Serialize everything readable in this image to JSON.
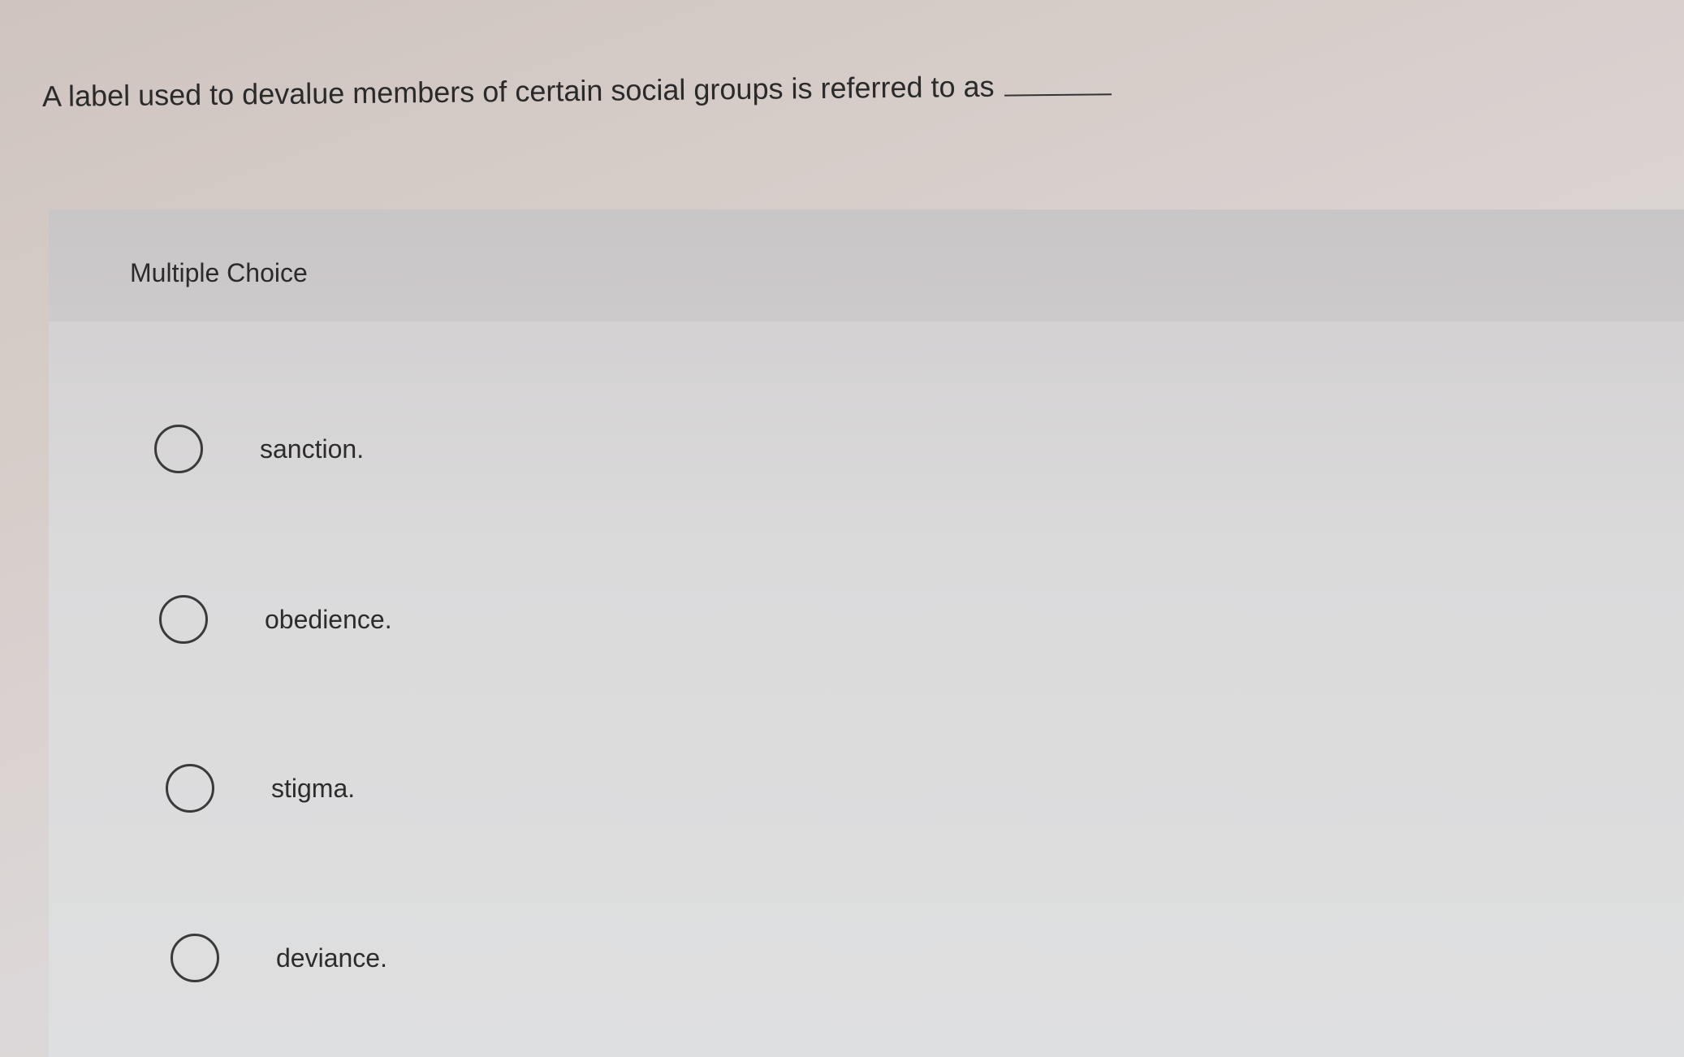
{
  "question": {
    "text": "A label used to devalue members of certain social groups is referred to as"
  },
  "multiple_choice": {
    "title": "Multiple Choice",
    "options": [
      {
        "label": "sanction."
      },
      {
        "label": "obedience."
      },
      {
        "label": "stigma."
      },
      {
        "label": "deviance."
      }
    ]
  }
}
